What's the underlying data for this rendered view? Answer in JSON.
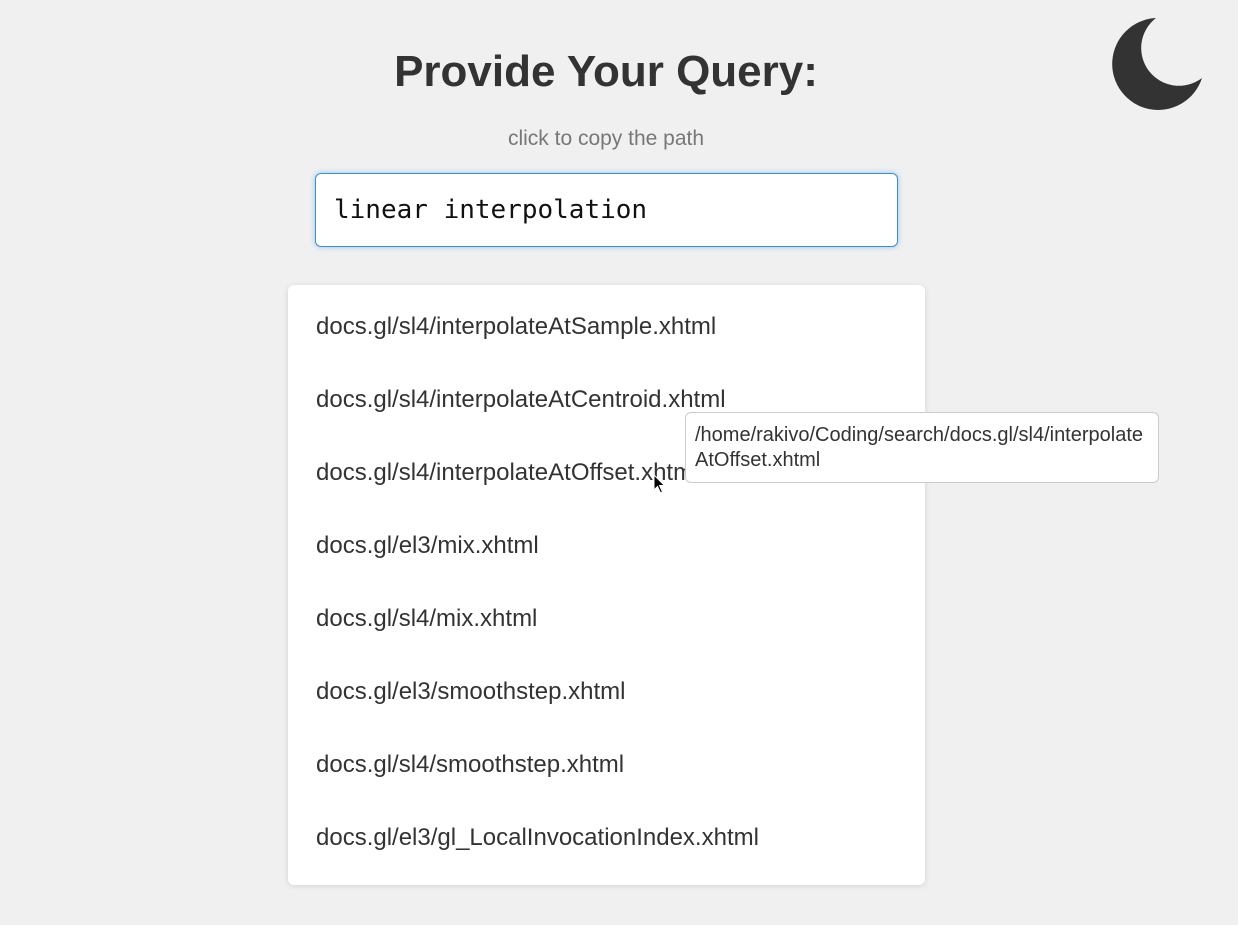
{
  "page": {
    "title": "Provide Your Query:",
    "subtitle": "click to copy the path",
    "theme_toggle_icon": "moon-icon"
  },
  "search": {
    "value": "linear interpolation",
    "placeholder": ""
  },
  "results": [
    {
      "label": "docs.gl/sl4/interpolateAtSample.xhtml"
    },
    {
      "label": "docs.gl/sl4/interpolateAtCentroid.xhtml"
    },
    {
      "label": "docs.gl/sl4/interpolateAtOffset.xhtml"
    },
    {
      "label": "docs.gl/el3/mix.xhtml"
    },
    {
      "label": "docs.gl/sl4/mix.xhtml"
    },
    {
      "label": "docs.gl/el3/smoothstep.xhtml"
    },
    {
      "label": "docs.gl/sl4/smoothstep.xhtml"
    },
    {
      "label": "docs.gl/el3/gl_LocalInvocationIndex.xhtml"
    }
  ],
  "tooltip": {
    "text": "/home/rakivo/Coding/search/docs.gl/sl4/interpolateAtOffset.xhtml"
  },
  "colors": {
    "background": "#f0f0f0",
    "text": "#333333",
    "accent": "#3b8fd9"
  }
}
